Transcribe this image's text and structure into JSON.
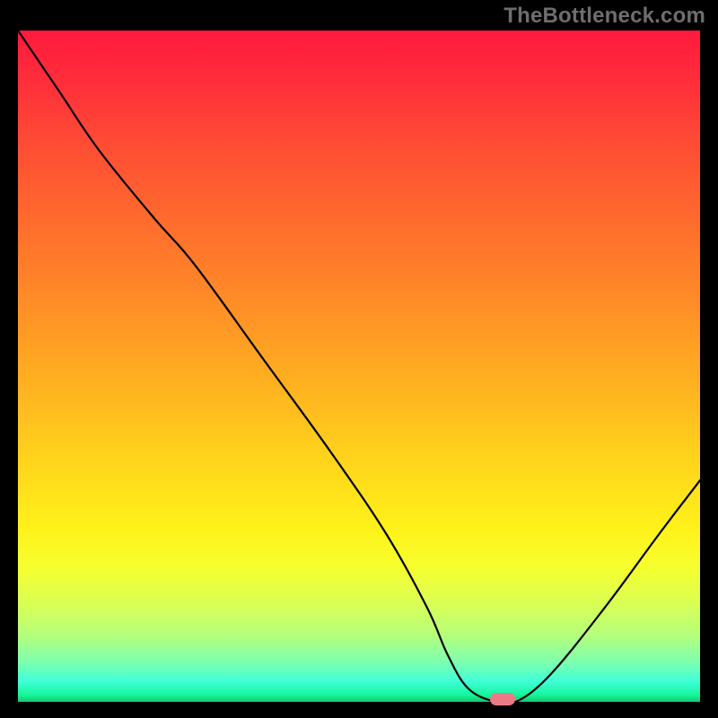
{
  "watermark": "TheBottleneck.com",
  "chart_data": {
    "type": "line",
    "title": "",
    "xlabel": "",
    "ylabel": "",
    "xlim": [
      0,
      100
    ],
    "ylim": [
      0,
      100
    ],
    "grid": false,
    "legend": false,
    "background_gradient": {
      "top": "#ff1a3e",
      "middle": "#ffd41b",
      "bottom": "#14c76e"
    },
    "series": [
      {
        "name": "bottleneck-curve",
        "color": "#000000",
        "x": [
          0,
          6,
          12,
          20,
          26,
          36,
          46,
          54,
          60,
          63,
          66,
          70,
          73,
          78,
          86,
          94,
          100
        ],
        "values": [
          100,
          91,
          82,
          72,
          65,
          51,
          37,
          25,
          14,
          7,
          2,
          0,
          0,
          4,
          14,
          25,
          33
        ]
      }
    ],
    "marker": {
      "x": 71,
      "y": 0,
      "color": "#ec7a86",
      "label": "optimal-point"
    }
  }
}
